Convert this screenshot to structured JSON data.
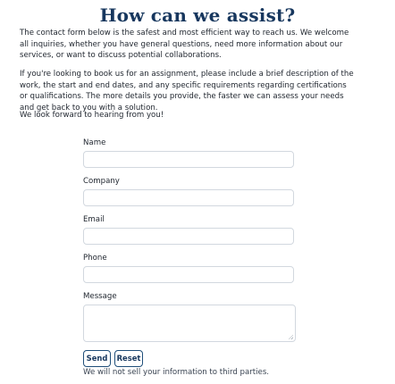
{
  "heading": "How can we assist?",
  "intro": {
    "paragraph1": "The contact form below is the safest and most efficient way to reach us. We welcome all inquiries, whether you have general questions, need more information about our services, or want to discuss potential collaborations.",
    "paragraph2": "If you're looking to book us for an assignment, please include a brief description of the work, the start and end dates, and any specific requirements regarding certifications or qualifications. The more details you provide, the faster we can assess your needs and get back to you with a solution.",
    "paragraph3": "We look forward to hearing from you!"
  },
  "form": {
    "name_label": "Name",
    "name_value": "",
    "company_label": "Company",
    "company_value": "",
    "email_label": "Email",
    "email_value": "",
    "phone_label": "Phone",
    "phone_value": "",
    "message_label": "Message",
    "message_value": "",
    "send_label": "Send",
    "reset_label": "Reset",
    "privacy_note": "We will not sell your information to third parties."
  }
}
